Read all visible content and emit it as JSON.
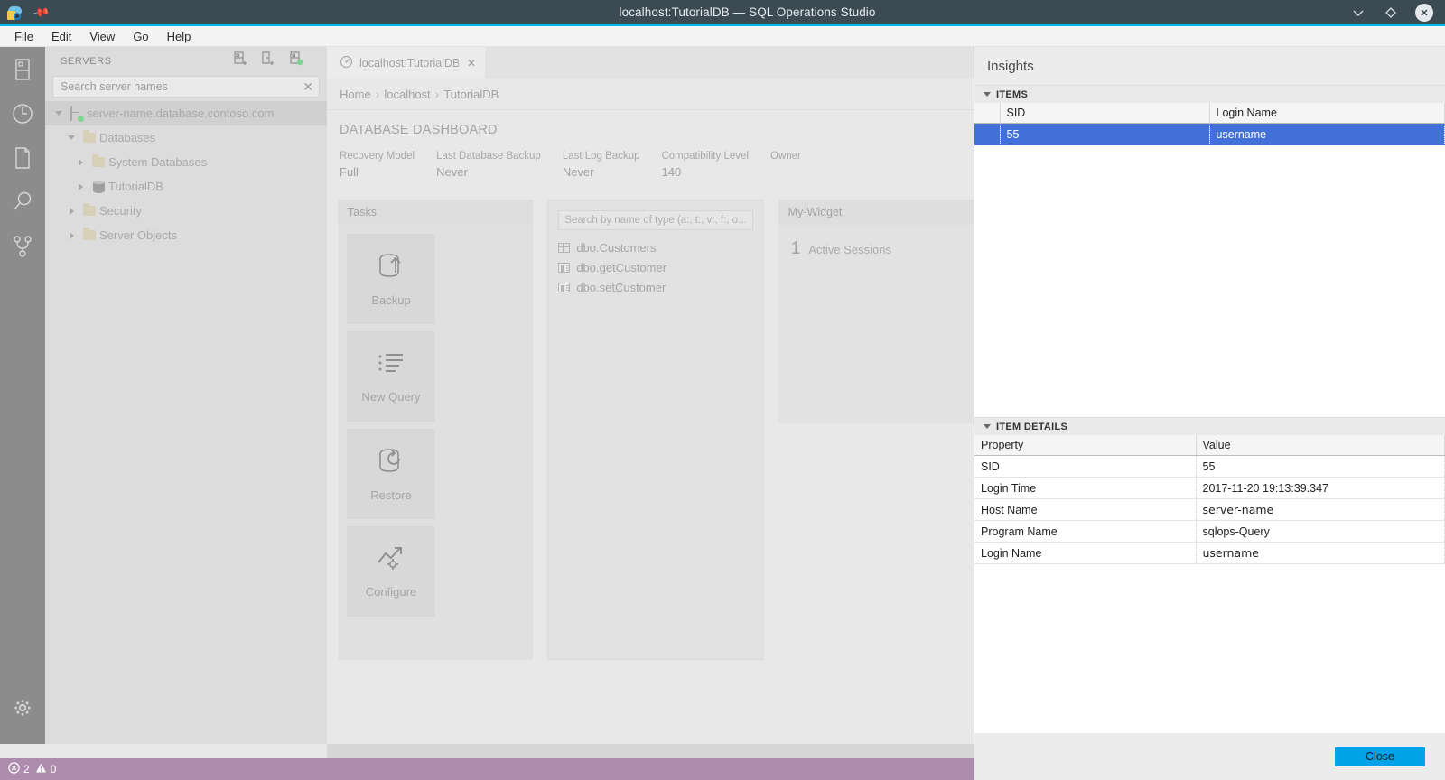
{
  "titlebar": {
    "title": "localhost:TutorialDB — SQL Operations Studio",
    "logo_icon": "sqlops-logo-icon",
    "pin_icon": "pin-icon",
    "minimize_icon": "chevron-down-icon",
    "restore_icon": "diamond-restore-icon",
    "close_icon": "close-icon",
    "accent_color": "#00bcf2",
    "bg_color": "#3c4a54"
  },
  "menubar": {
    "items": [
      {
        "label": "File",
        "name": "menu-file"
      },
      {
        "label": "Edit",
        "name": "menu-edit"
      },
      {
        "label": "View",
        "name": "menu-view"
      },
      {
        "label": "Go",
        "name": "menu-go"
      },
      {
        "label": "Help",
        "name": "menu-help"
      }
    ]
  },
  "activitybar": {
    "items": [
      {
        "icon": "servers-icon",
        "name": "activity-servers"
      },
      {
        "icon": "history-clock-icon",
        "name": "activity-history"
      },
      {
        "icon": "file-page-icon",
        "name": "activity-files"
      },
      {
        "icon": "search-magnifier-icon",
        "name": "activity-search"
      },
      {
        "icon": "source-control-branch-icon",
        "name": "activity-source-control"
      }
    ],
    "settings": {
      "icon": "gear-icon",
      "name": "activity-settings"
    }
  },
  "sidebar": {
    "title": "SERVERS",
    "actions": [
      {
        "icon": "add-server-icon",
        "name": "add-connection-button"
      },
      {
        "icon": "add-server-group-icon",
        "name": "add-server-group-button"
      },
      {
        "icon": "active-connections-icon",
        "name": "active-connections-button"
      }
    ],
    "search": {
      "placeholder": "Search server names",
      "value": "",
      "clear_icon": "clear-icon"
    },
    "tree": [
      {
        "label": "server-name.database.contoso.com",
        "icon": "server-icon",
        "indent": 0,
        "twisty": "down",
        "selected": true
      },
      {
        "label": "Databases",
        "icon": "folder-icon",
        "indent": 1,
        "twisty": "down",
        "selected": false
      },
      {
        "label": "System Databases",
        "icon": "folder-icon",
        "indent": 2,
        "twisty": "right",
        "selected": false
      },
      {
        "label": "TutorialDB",
        "icon": "database-icon",
        "indent": 2,
        "twisty": "right",
        "selected": false
      },
      {
        "label": "Security",
        "icon": "folder-icon",
        "indent": 1,
        "twisty": "right",
        "selected": false
      },
      {
        "label": "Server Objects",
        "icon": "folder-icon",
        "indent": 1,
        "twisty": "right",
        "selected": false
      }
    ]
  },
  "editor": {
    "tab": {
      "label": "localhost:TutorialDB",
      "icon": "dashboard-gauge-icon",
      "close_icon": "close-icon"
    },
    "breadcrumb": [
      "Home",
      "localhost",
      "TutorialDB"
    ],
    "dashboard_title": "DATABASE DASHBOARD",
    "properties": [
      {
        "label": "Recovery Model",
        "value": "Full"
      },
      {
        "label": "Last Database Backup",
        "value": "Never"
      },
      {
        "label": "Last Log Backup",
        "value": "Never"
      },
      {
        "label": "Compatibility Level",
        "value": "140"
      },
      {
        "label": "Owner",
        "value": ""
      }
    ],
    "tasks_widget": {
      "title": "Tasks",
      "tiles": [
        {
          "label": "Backup",
          "icon": "backup-upload-icon"
        },
        {
          "label": "New Query",
          "icon": "new-query-list-icon"
        },
        {
          "label": "Restore",
          "icon": "restore-refresh-icon"
        },
        {
          "label": "Configure",
          "icon": "configure-chart-gear-icon"
        }
      ]
    },
    "search_widget": {
      "placeholder": "Search by name of type (a:, t:, v:, f:, o...",
      "value": "",
      "objects": [
        {
          "label": "dbo.Customers",
          "icon": "table-grid-icon"
        },
        {
          "label": "dbo.getCustomer",
          "icon": "stored-procedure-icon"
        },
        {
          "label": "dbo.setCustomer",
          "icon": "stored-procedure-icon"
        }
      ]
    },
    "my_widget": {
      "title": "My-Widget",
      "count": "1",
      "label": "Active Sessions"
    }
  },
  "insights": {
    "title": "Insights",
    "items_section": {
      "heading": "ITEMS",
      "columns": [
        "SID",
        "Login Name"
      ],
      "rows": [
        {
          "cells": [
            "55",
            "username"
          ],
          "selected": true
        }
      ]
    },
    "details_section": {
      "heading": "ITEM DETAILS",
      "columns": [
        "Property",
        "Value"
      ],
      "rows": [
        {
          "property": "SID",
          "value": "55"
        },
        {
          "property": "Login Time",
          "value": "2017-11-20 19:13:39.347"
        },
        {
          "property": "Host Name",
          "value": "server-name"
        },
        {
          "property": "Program Name",
          "value": "sqlops-Query"
        },
        {
          "property": "Login Name",
          "value": "username"
        }
      ]
    },
    "close_label": "Close",
    "close_color": "#00a2e8",
    "selection_color": "#4170d8"
  },
  "statusbar": {
    "error_icon": "error-circle-icon",
    "error_count": "2",
    "warning_icon": "warning-triangle-icon",
    "warning_count": "0",
    "bg_color": "#ad8cad"
  }
}
